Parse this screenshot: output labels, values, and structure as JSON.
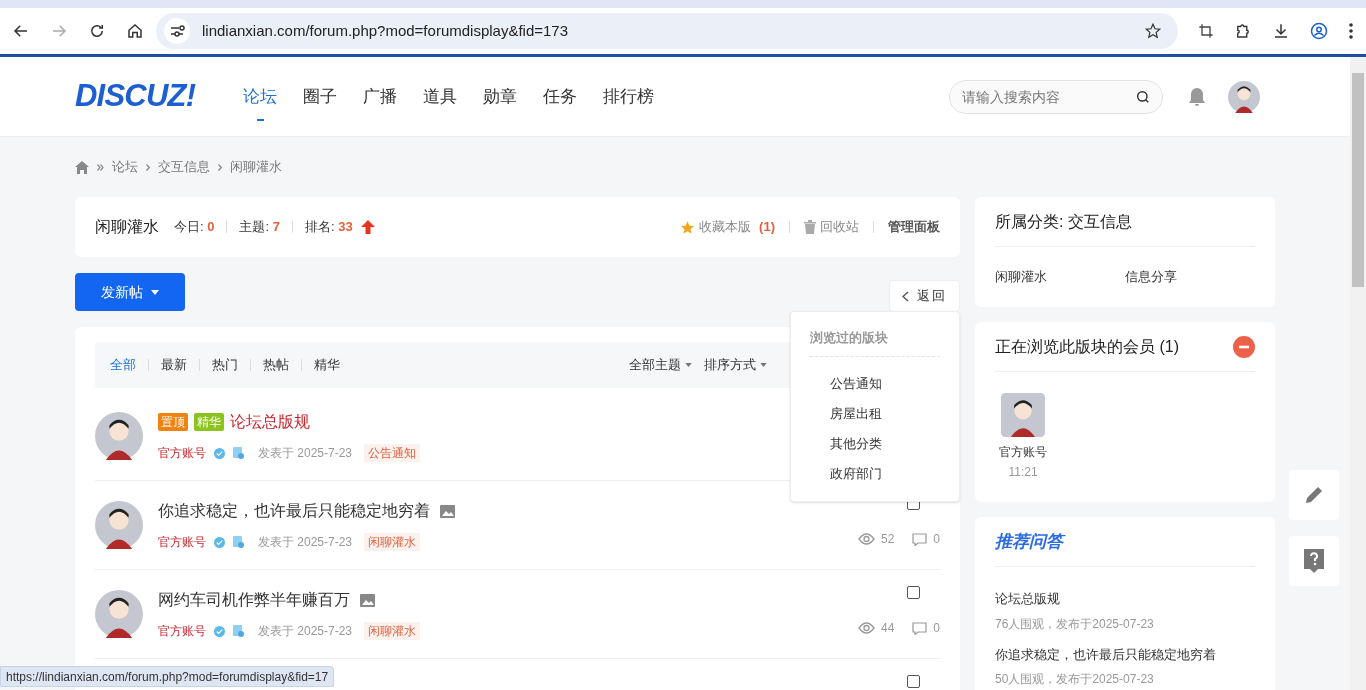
{
  "browser": {
    "url": "lindianxian.com/forum.php?mod=forumdisplay&fid=173",
    "status_url": "https://lindianxian.com/forum.php?mod=forumdisplay&fid=17"
  },
  "header": {
    "logo": "DISCUZ!",
    "nav": [
      {
        "label": "论坛",
        "selected": true
      },
      {
        "label": "圈子",
        "selected": false
      },
      {
        "label": "广播",
        "selected": false
      },
      {
        "label": "道具",
        "selected": false
      },
      {
        "label": "勋章",
        "selected": false
      },
      {
        "label": "任务",
        "selected": false
      },
      {
        "label": "排行榜",
        "selected": false
      }
    ],
    "search": {
      "placeholder": "请输入搜索内容"
    }
  },
  "breadcrumb": [
    "论坛",
    "交互信息",
    "闲聊灌水"
  ],
  "forum": {
    "name": "闲聊灌水",
    "stats": [
      {
        "label": "今日:",
        "value": "0"
      },
      {
        "label": "主题:",
        "value": "7"
      },
      {
        "label": "排名:",
        "value": "33"
      }
    ],
    "actions": [
      {
        "kind": "favorite",
        "label": "收藏本版",
        "count": "(1)"
      },
      {
        "kind": "recycle",
        "label": "回收站"
      },
      {
        "kind": "manage",
        "label": "管理面板"
      }
    ]
  },
  "new_post_button": "发新帖",
  "back_button": "返回",
  "filters": [
    {
      "label": "全部",
      "selected": true
    },
    {
      "label": "最新",
      "selected": false
    },
    {
      "label": "热门",
      "selected": false
    },
    {
      "label": "热帖",
      "selected": false
    },
    {
      "label": "精华",
      "selected": false
    }
  ],
  "sort": [
    "全部主题",
    "排序方式"
  ],
  "threads": [
    {
      "kind": "full",
      "tags": [
        {
          "label": "置顶",
          "color": "#f0820f"
        },
        {
          "label": "精华",
          "color": "#8cc31e"
        }
      ],
      "title": "论坛总版规",
      "highlight": true,
      "has_image": false,
      "author": "官方账号",
      "date": "发表于 2025-7-23",
      "category": "公告通知"
    },
    {
      "kind": "full",
      "title": "你追求稳定，也许最后只能稳定地穷着",
      "highlight": false,
      "has_image": true,
      "author": "官方账号",
      "date": "发表于 2025-7-23",
      "category": "闲聊灌水",
      "views": "52",
      "replies": "0",
      "checked": false
    },
    {
      "kind": "full",
      "title": "网约车司机作弊半年赚百万",
      "highlight": false,
      "has_image": true,
      "author": "官方账号",
      "date": "发表于 2025-7-23",
      "category": "闲聊灌水",
      "views": "44",
      "replies": "0",
      "checked": false
    },
    {
      "kind": "partial",
      "checked": false
    }
  ],
  "recent_forums": {
    "title": "浏览过的版块",
    "items": [
      "公告通知",
      "房屋出租",
      "其他分类",
      "政府部门"
    ]
  },
  "sidebar": {
    "category_card": {
      "title": "所属分类: 交互信息",
      "links": [
        "闲聊灌水",
        "信息分享"
      ]
    },
    "members_card": {
      "title": "正在浏览此版块的会员 (1)",
      "expanded": true,
      "members": [
        {
          "name": "官方账号",
          "time": "11:21"
        }
      ]
    },
    "qa_card": {
      "title": "推荐问答",
      "items": [
        {
          "title": "论坛总版规",
          "meta": "76人围观，发布于2025-07-23"
        },
        {
          "title": "你追求稳定，也许最后只能稳定地穷着",
          "meta": "50人围观，发布于2025-07-23"
        }
      ]
    }
  }
}
